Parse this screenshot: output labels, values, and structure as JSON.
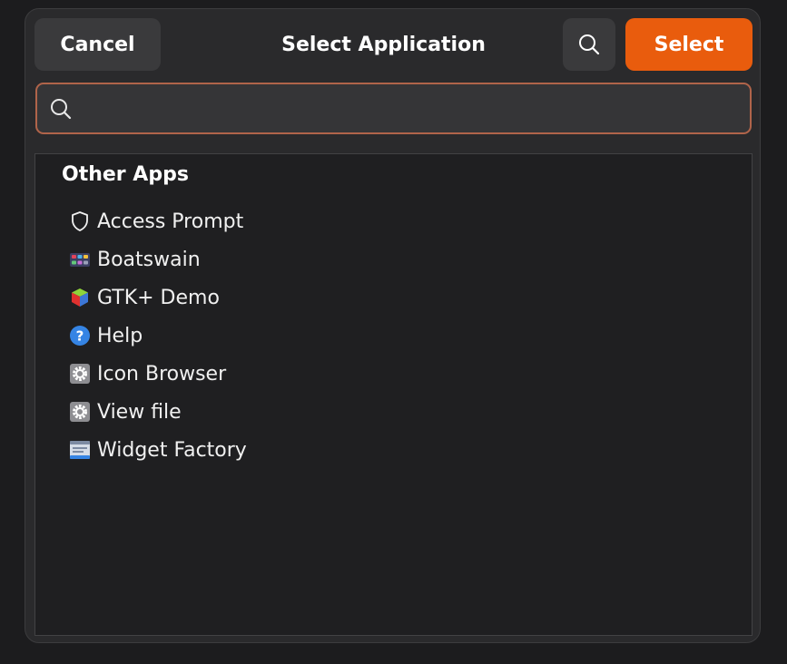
{
  "header": {
    "cancel_label": "Cancel",
    "title": "Select Application",
    "select_label": "Select"
  },
  "search": {
    "value": "",
    "placeholder": ""
  },
  "section": {
    "title": "Other Apps"
  },
  "apps": [
    {
      "label": "Access Prompt",
      "icon": "shield-icon"
    },
    {
      "label": "Boatswain",
      "icon": "boatswain-icon"
    },
    {
      "label": "GTK+ Demo",
      "icon": "gtk-cube-icon"
    },
    {
      "label": "Help",
      "icon": "help-icon"
    },
    {
      "label": "Icon Browser",
      "icon": "gear-icon"
    },
    {
      "label": "View file",
      "icon": "gear-icon"
    },
    {
      "label": "Widget Factory",
      "icon": "widget-factory-icon"
    }
  ],
  "colors": {
    "accent": "#e95c0d",
    "focus_border": "#b0644a"
  }
}
